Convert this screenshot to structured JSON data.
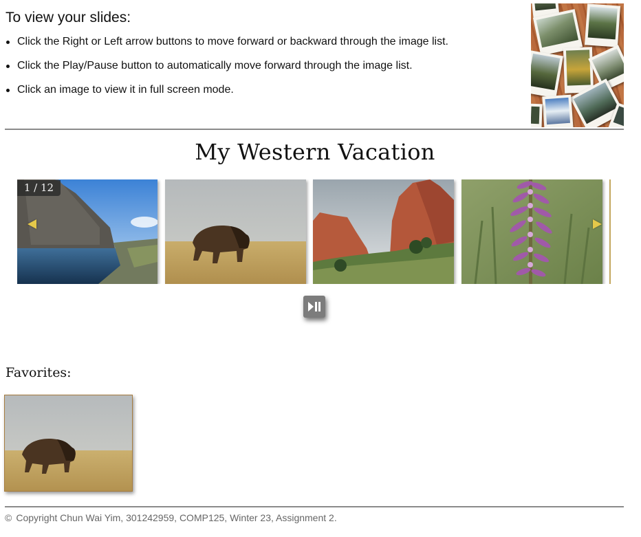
{
  "instructions": {
    "heading": "To view your slides:",
    "items": [
      "Click the Right or Left arrow buttons to move forward or backward through the image list.",
      "Click the Play/Pause button to automatically move forward through the image list.",
      "Click an image to view it in full screen mode."
    ]
  },
  "slideshow": {
    "title": "My Western Vacation",
    "counter": "1 / 12",
    "slides": [
      {
        "subject": "mountain lake"
      },
      {
        "subject": "bison"
      },
      {
        "subject": "red rocks"
      },
      {
        "subject": "purple wildflower"
      }
    ],
    "controls": {
      "prev_icon": "left-arrow-icon",
      "next_icon": "right-arrow-icon",
      "play_pause_icon": "play-pause-icon"
    }
  },
  "favorites": {
    "title": "Favorites:",
    "items": [
      {
        "subject": "bison"
      }
    ]
  },
  "footer": {
    "copyright_symbol": "©",
    "text": "Copyright Chun Wai Yim, 301242959, COMP125, Winter 23, Assignment 2."
  },
  "colors": {
    "arrow": "#e5c84a",
    "play_button": "#7c7c7c",
    "rule": "#8a8a8a",
    "footer_text": "#666666"
  }
}
